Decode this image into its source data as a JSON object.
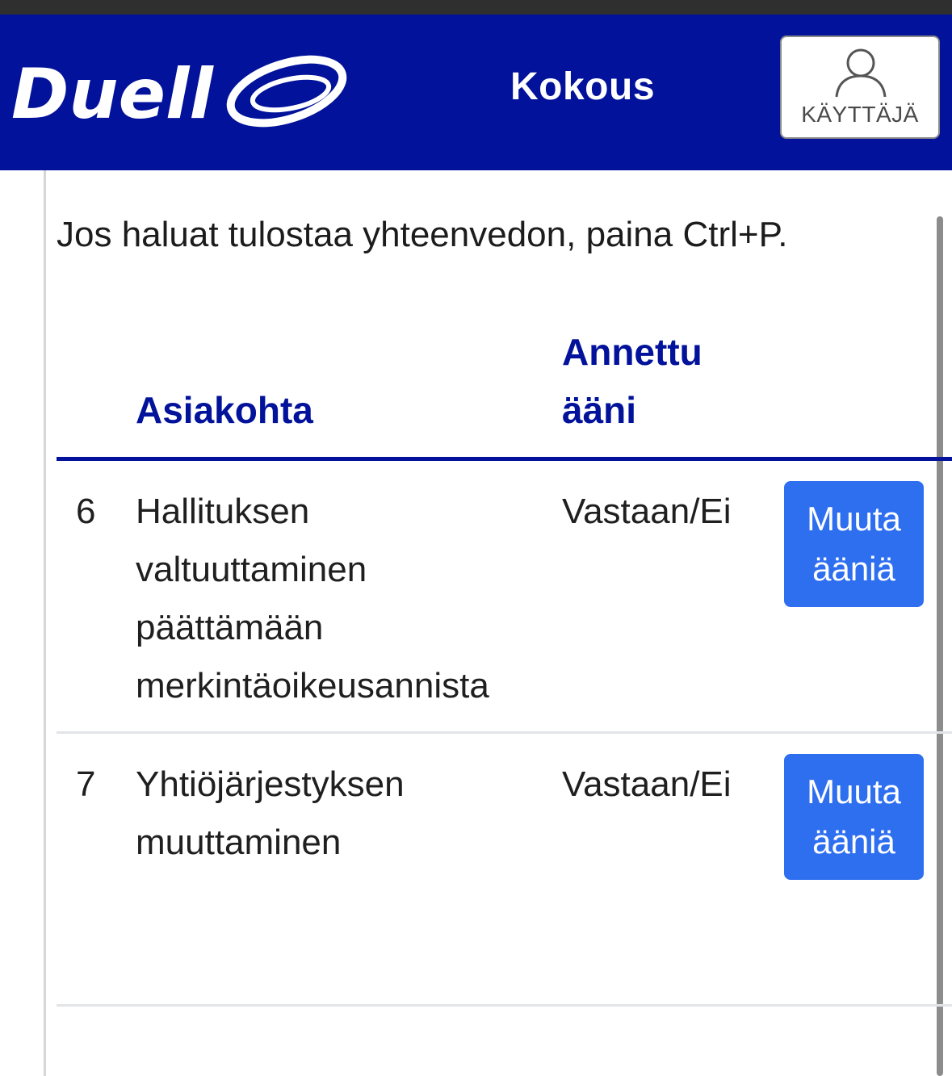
{
  "header": {
    "brand": "Duell",
    "title": "Kokous",
    "user_button_label": "KÄYTTÄJÄ",
    "background_color": "#02129a"
  },
  "main": {
    "print_hint": "Jos haluat tulostaa yhteenvedon, paina Ctrl+P.",
    "table": {
      "columns": {
        "item": "Asiakohta",
        "vote_line1": "Annettu",
        "vote_line2": "ääni"
      },
      "rows": [
        {
          "number": "6",
          "title_lines": [
            "Hallituksen",
            "valtuuttaminen",
            "päättämään",
            "merkintäoikeusannista"
          ],
          "vote": "Vastaan/Ei",
          "button_lines": [
            "Muuta",
            "ääniä"
          ]
        },
        {
          "number": "7",
          "title_lines": [
            "Yhtiöjärjestyksen",
            "muuttaminen"
          ],
          "vote": "Vastaan/Ei",
          "button_lines": [
            "Muuta",
            "ääniä"
          ]
        }
      ]
    }
  },
  "colors": {
    "accent": "#02129a",
    "button": "#2e6ff0"
  },
  "icons": {
    "user": "user-icon"
  }
}
